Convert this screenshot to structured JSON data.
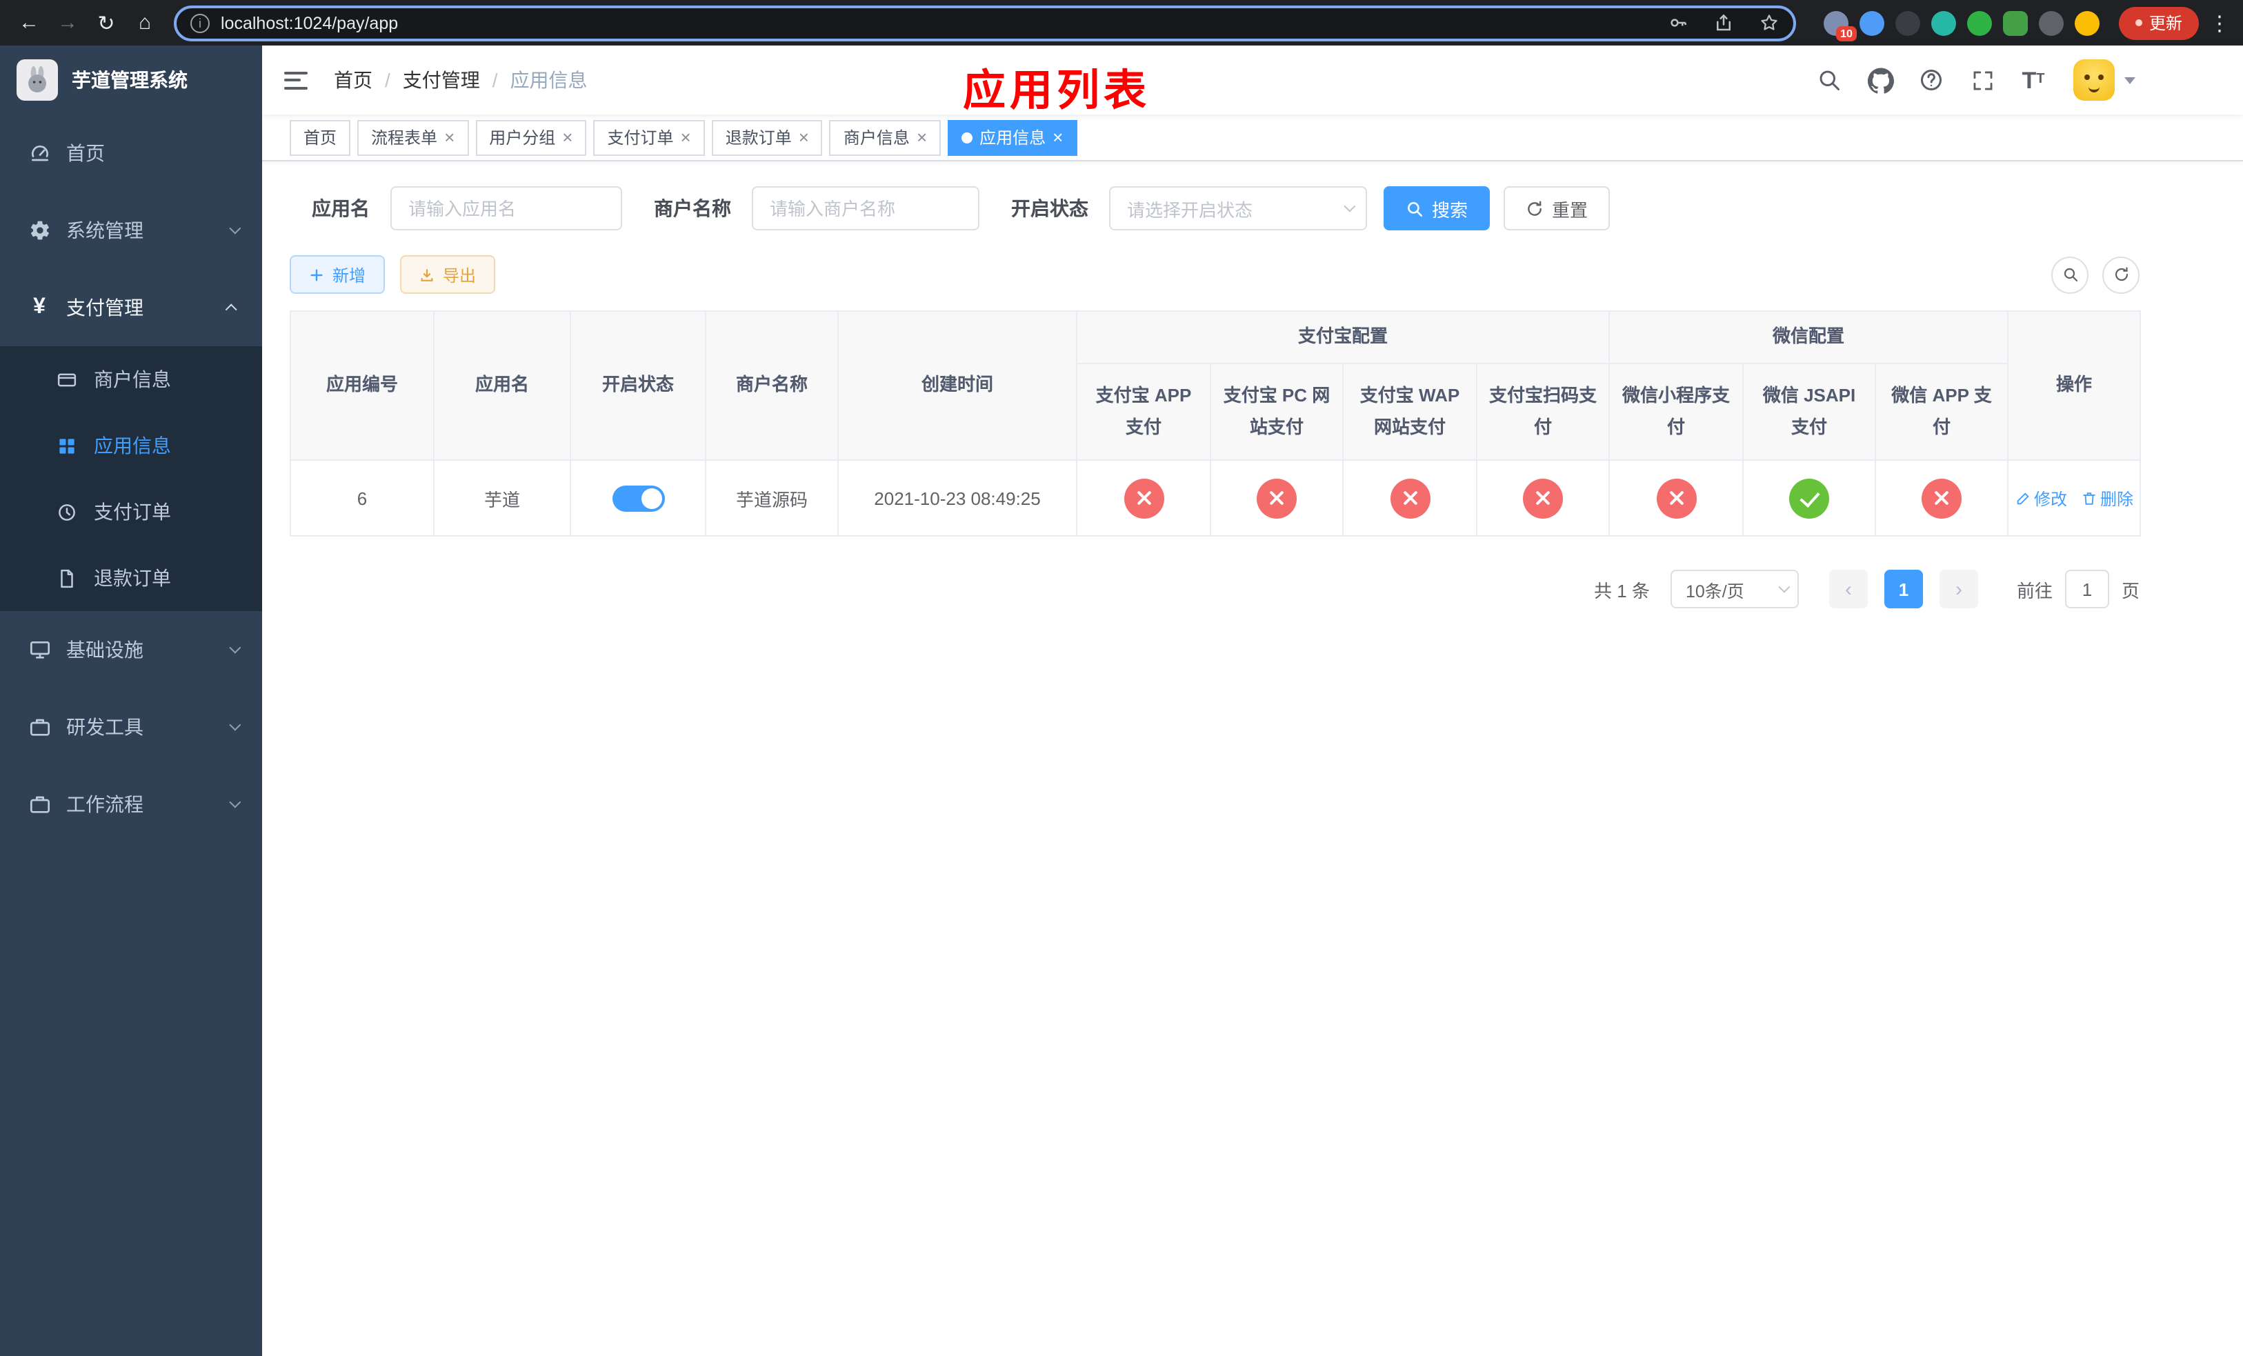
{
  "colors": {
    "accent": "#409EFF",
    "danger": "#F56C6C",
    "success": "#67C23A",
    "annotation": "#FE0000"
  },
  "browser": {
    "url": "localhost:1024/pay/app",
    "update_label": "更新",
    "extension_badge": "10"
  },
  "sidebar": {
    "title": "芋道管理系统",
    "items": [
      {
        "label": "首页"
      },
      {
        "label": "系统管理"
      },
      {
        "label": "支付管理"
      },
      {
        "label": "商户信息"
      },
      {
        "label": "应用信息"
      },
      {
        "label": "支付订单"
      },
      {
        "label": "退款订单"
      },
      {
        "label": "基础设施"
      },
      {
        "label": "研发工具"
      },
      {
        "label": "工作流程"
      }
    ]
  },
  "navbar": {
    "breadcrumb": [
      "首页",
      "支付管理",
      "应用信息"
    ],
    "separator": "/",
    "annotation": "应用列表"
  },
  "tabs": [
    {
      "label": "首页"
    },
    {
      "label": "流程表单"
    },
    {
      "label": "用户分组"
    },
    {
      "label": "支付订单"
    },
    {
      "label": "退款订单"
    },
    {
      "label": "商户信息"
    },
    {
      "label": "应用信息"
    }
  ],
  "filters": {
    "app_name_label": "应用名",
    "app_name_placeholder": "请输入应用名",
    "merchant_label": "商户名称",
    "merchant_placeholder": "请输入商户名称",
    "status_label": "开启状态",
    "status_placeholder": "请选择开启状态",
    "search_button": "搜索",
    "reset_button": "重置"
  },
  "toolbar": {
    "add_button": "新增",
    "export_button": "导出"
  },
  "table": {
    "group_alipay": "支付宝配置",
    "group_wechat": "微信配置",
    "col_id": "应用编号",
    "col_name": "应用名",
    "col_status": "开启状态",
    "col_merchant": "商户名称",
    "col_created": "创建时间",
    "col_alipay_app": "支付宝 APP 支付",
    "col_alipay_pc": "支付宝 PC 网站支付",
    "col_alipay_wap": "支付宝 WAP 网站支付",
    "col_alipay_qr": "支付宝扫码支付",
    "col_wx_mini": "微信小程序支付",
    "col_wx_jsapi": "微信 JSAPI 支付",
    "col_wx_app": "微信 APP 支付",
    "col_actions": "操作",
    "row": {
      "id": "6",
      "name": "芋道",
      "enabled": true,
      "merchant": "芋道源码",
      "created_at": "2021-10-23 08:49:25",
      "configs": [
        "disabled",
        "disabled",
        "disabled",
        "disabled",
        "disabled",
        "enabled",
        "disabled"
      ],
      "edit_label": "修改",
      "delete_label": "删除"
    }
  },
  "pagination": {
    "total": "共 1 条",
    "page_size": "10条/页",
    "current_page": "1",
    "goto_label": "前往",
    "goto_value": "1",
    "page_unit": "页"
  }
}
